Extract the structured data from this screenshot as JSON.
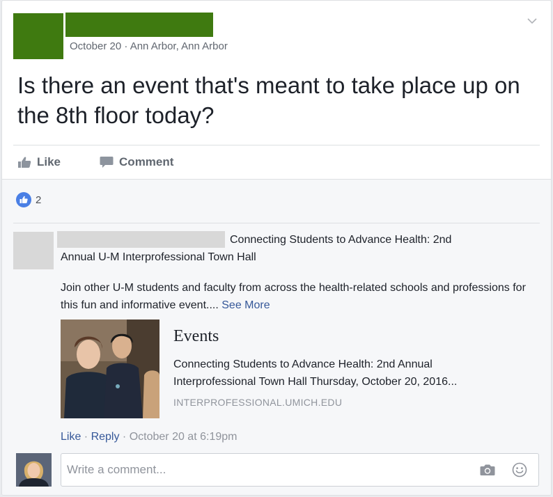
{
  "post": {
    "meta": "October 20 · Ann Arbor, Ann Arbor",
    "text": "Is there an event that's meant to take place up on the 8th floor today?",
    "like_label": "Like",
    "comment_label": "Comment",
    "reaction_count": "2"
  },
  "comment": {
    "line1": "Connecting Students to Advance Health: 2nd",
    "line2": "Annual U-M Interprofessional Town Hall",
    "body": "Join other U-M students and faculty from across the health-related schools and professions for this fun and informative event....",
    "see_more": "See More",
    "link_card": {
      "site": "Events",
      "description": "Connecting Students to Advance Health: 2nd Annual Interprofessional Town Hall Thursday, October 20, 2016...",
      "domain": "INTERPROFESSIONAL.UMICH.EDU"
    },
    "like_label": "Like",
    "reply_label": "Reply",
    "timestamp": "October 20 at 6:19pm",
    "separator": " · "
  },
  "composer": {
    "placeholder": "Write a comment..."
  },
  "colors": {
    "redaction_green": "#3f7a10",
    "redaction_gray": "#d8d8d8",
    "link_blue": "#365899",
    "like_blue": "#4a7fe5"
  }
}
